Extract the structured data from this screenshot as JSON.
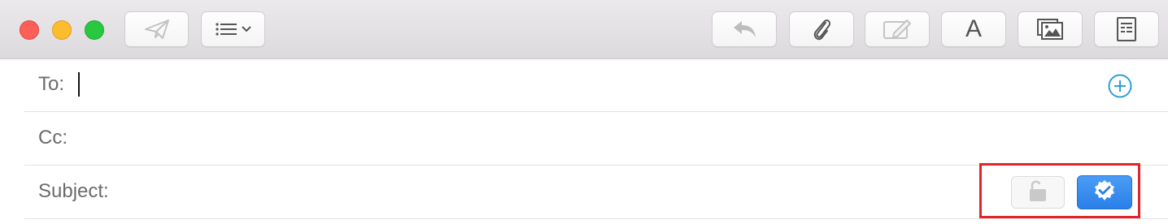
{
  "window": {
    "controls": [
      "close",
      "minimize",
      "zoom"
    ]
  },
  "toolbar": {
    "left_buttons": [
      {
        "name": "send",
        "icon": "paper-plane-icon"
      },
      {
        "name": "header-fields",
        "icon": "list-icon",
        "has_menu": true
      }
    ],
    "right_buttons": [
      {
        "name": "reply",
        "icon": "reply-arrow-icon"
      },
      {
        "name": "attach",
        "icon": "paperclip-icon"
      },
      {
        "name": "markup",
        "icon": "pencil-note-icon"
      },
      {
        "name": "format",
        "icon": "font-icon",
        "label": "A"
      },
      {
        "name": "photo-browser",
        "icon": "photo-icon"
      },
      {
        "name": "stationery",
        "icon": "stationery-icon"
      }
    ]
  },
  "compose": {
    "to_label": "To:",
    "cc_label": "Cc:",
    "subject_label": "Subject:",
    "to_value": "",
    "cc_value": "",
    "subject_value": ""
  },
  "security": {
    "encrypt_state": "unlocked",
    "sign_state": "on",
    "highlight_color": "#e0242a",
    "sign_color": "#3b8ff0"
  }
}
